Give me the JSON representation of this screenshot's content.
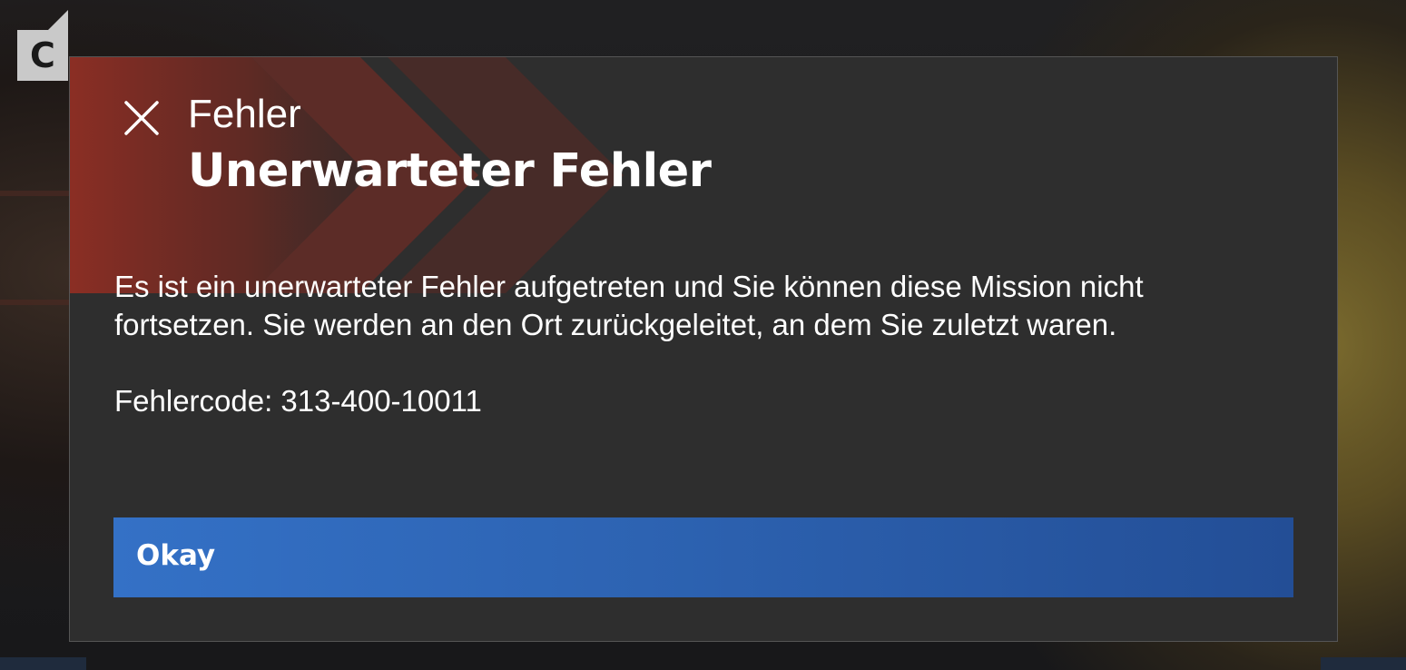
{
  "badge": {
    "label": "C",
    "icon": "controller-button-c"
  },
  "dialog": {
    "close_icon": "close-icon",
    "category": "Fehler",
    "title": "Unerwarteter Fehler",
    "message": "Es ist ein unerwarteter Fehler aufgetreten und Sie können diese Mission nicht fortsetzen. Sie werden an den Ort zurückgeleitet, an dem Sie zuletzt waren.",
    "error_code": "Fehlercode: 313-400-10011",
    "confirm_label": "Okay"
  },
  "colors": {
    "dialog_background": "#2e2e2e",
    "accent_red": "#a12e22",
    "button_blue": "#2d63b2",
    "text": "#ffffff"
  }
}
